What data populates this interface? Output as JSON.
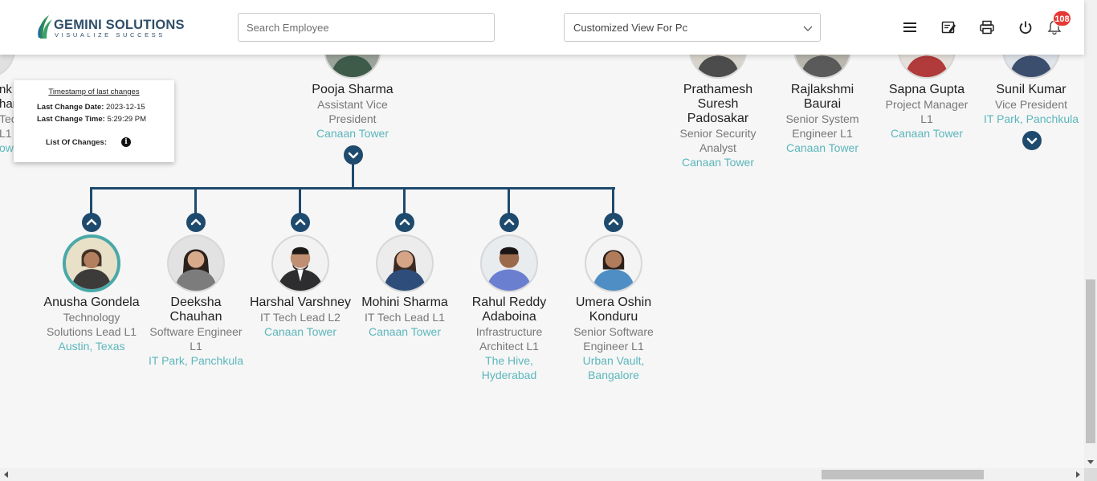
{
  "header": {
    "logo_name": "GEMINI SOLUTIONS",
    "logo_tagline": "VISUALIZE SUCCESS",
    "search_placeholder": "Search Employee",
    "view_selected": "Customized View For Pc",
    "notification_count": "108",
    "icons": [
      "menu-icon",
      "edit-note-icon",
      "print-icon",
      "power-icon",
      "bell-icon"
    ]
  },
  "timestamp_card": {
    "title": "Timestamp of last changes",
    "date_label": "Last Change Date:",
    "date_value": "2023-12-15",
    "time_label": "Last Change Time:",
    "time_value": "5:29:29 PM",
    "changes_label": "List Of Changes:",
    "info_glyph": "i"
  },
  "partial_left": {
    "line1": "nk",
    "line2": "har",
    "line3": "Tec",
    "line4": "L1",
    "line5": "ow"
  },
  "manager": {
    "name": "Pooja Sharma",
    "title": "Assistant Vice President",
    "location": "Canaan Tower"
  },
  "top_row": [
    {
      "name": "Prathamesh Suresh Padosakar",
      "title": "Senior Security Analyst",
      "location": "Canaan Tower"
    },
    {
      "name": "Rajlakshmi Baurai",
      "title": "Senior System Engineer L1",
      "location": "Canaan Tower"
    },
    {
      "name": "Sapna Gupta",
      "title": "Project Manager L1",
      "location": "Canaan Tower"
    },
    {
      "name": "Sunil Kumar",
      "title": "Vice President",
      "location": "IT Park, Panchkula"
    }
  ],
  "reports": [
    {
      "name": "Anusha Gondela",
      "title": "Technology Solutions Lead L1",
      "location": "Austin, Texas"
    },
    {
      "name": "Deeksha Chauhan",
      "title": "Software Engineer L1",
      "location": "IT Park, Panchkula"
    },
    {
      "name": "Harshal Varshney",
      "title": "IT Tech Lead L2",
      "location": "Canaan Tower"
    },
    {
      "name": "Mohini Sharma",
      "title": "IT Tech Lead L1",
      "location": "Canaan Tower"
    },
    {
      "name": "Rahul Reddy Adaboina",
      "title": "Infrastructure Architect L1",
      "location": "The Hive, Hyderabad"
    },
    {
      "name": "Umera Oshin Konduru",
      "title": "Senior Software Engineer L1",
      "location": "Urban Vault, Bangalore"
    }
  ],
  "colors": {
    "accent": "#1e4a6e",
    "location": "#5bb6bc",
    "badge": "#e53935",
    "selected_ring": "#4aa8a8"
  }
}
